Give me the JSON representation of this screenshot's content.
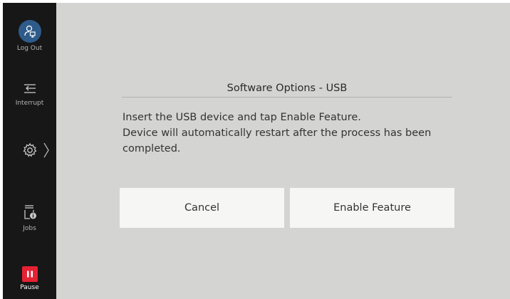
{
  "sidebar": {
    "logout": {
      "label": "Log Out",
      "icon": "logout-user-icon",
      "circle_color": "#2e5b8a"
    },
    "interrupt": {
      "label": "Interrupt",
      "icon": "interrupt-icon"
    },
    "settings": {
      "icon": "gear-icon",
      "chevron": "chevron-right-icon"
    },
    "jobs": {
      "label": "Jobs",
      "icon": "jobs-icon"
    },
    "pause": {
      "label": "Pause",
      "icon": "pause-icon",
      "color": "#e52233"
    }
  },
  "dialog": {
    "title": "Software Options - USB",
    "line1": "Insert the USB device and tap Enable Feature.",
    "line2": "Device will automatically restart after the process has been completed."
  },
  "buttons": {
    "cancel": "Cancel",
    "enable": "Enable Feature"
  },
  "colors": {
    "sidebar_bg": "#171717",
    "main_bg": "#d4d4d2",
    "button_bg": "#f6f6f4"
  }
}
